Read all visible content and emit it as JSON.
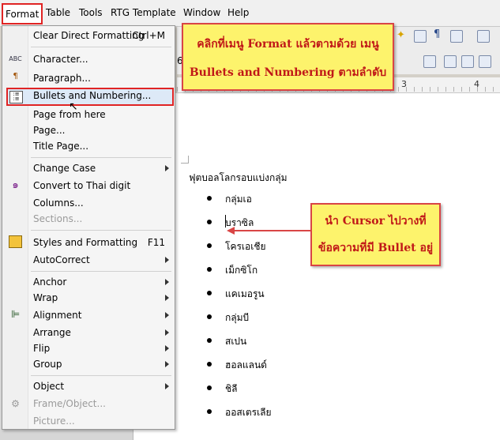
{
  "menubar": {
    "items": [
      "Format",
      "Table",
      "Tools",
      "RTG Template",
      "Window",
      "Help"
    ]
  },
  "ruler": {
    "marks": [
      "3",
      "4"
    ]
  },
  "format_menu": {
    "items": [
      {
        "label": "Clear Direct Formatting",
        "shortcut": "Ctrl+M"
      },
      {
        "label": "Character..."
      },
      {
        "label": "Paragraph..."
      },
      {
        "label": "Bullets and Numbering..."
      },
      {
        "label": "Page from here"
      },
      {
        "label": "Page..."
      },
      {
        "label": "Title Page..."
      },
      {
        "label": "Change Case"
      },
      {
        "label": "Convert to Thai digit"
      },
      {
        "label": "Columns..."
      },
      {
        "label": "Sections..."
      },
      {
        "label": "Styles and Formatting",
        "shortcut": "F11"
      },
      {
        "label": "AutoCorrect"
      },
      {
        "label": "Anchor"
      },
      {
        "label": "Wrap"
      },
      {
        "label": "Alignment"
      },
      {
        "label": "Arrange"
      },
      {
        "label": "Flip"
      },
      {
        "label": "Group"
      },
      {
        "label": "Object"
      },
      {
        "label": "Frame/Object..."
      },
      {
        "label": "Picture..."
      }
    ]
  },
  "document": {
    "heading": "ฟุตบอลโลกรอบแบ่งกลุ่ม",
    "bullets": [
      "กลุ่มเอ",
      "บราซิล",
      "โครเอเชีย",
      "เม็กซิโก",
      "แคเมอรูน",
      "กลุ่มบี",
      "สเปน",
      "ฮอลแลนด์",
      "ชิลี",
      "ออสเตรเลีย"
    ]
  },
  "callouts": {
    "menu_hint_line1": "คลิกที่เมนู Format แล้วตามด้วย เมนู",
    "menu_hint_line2": "Bullets and Numbering ตามลำดับ",
    "cursor_hint_line1": "นำ Cursor ไปวางที่",
    "cursor_hint_line2": "ข้อความที่มี Bullet อยู่"
  },
  "toolbar": {
    "icons": [
      "sun-icon",
      "grid-icon",
      "pilcrow-icon",
      "chart-icon",
      "list-icon",
      "indent-icon"
    ],
    "partial_value": "6"
  },
  "colors": {
    "highlight_border": "#e02424",
    "callout_fill": "#fdf36c",
    "callout_text": "#c01818"
  }
}
